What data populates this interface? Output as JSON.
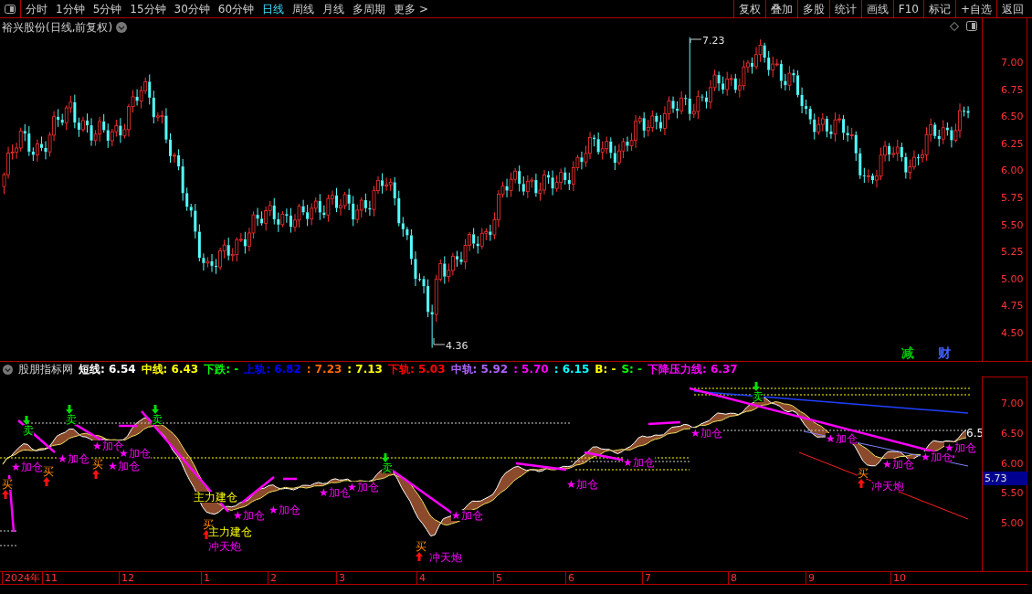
{
  "toolbar": {
    "periods": [
      {
        "label": "分时",
        "selected": false
      },
      {
        "label": "1分钟",
        "selected": false
      },
      {
        "label": "5分钟",
        "selected": false
      },
      {
        "label": "15分钟",
        "selected": false
      },
      {
        "label": "30分钟",
        "selected": false
      },
      {
        "label": "60分钟",
        "selected": false
      },
      {
        "label": "日线",
        "selected": true
      },
      {
        "label": "周线",
        "selected": false
      },
      {
        "label": "月线",
        "selected": false
      },
      {
        "label": "多周期",
        "selected": false
      }
    ],
    "more": "更多 >",
    "actions": [
      "复权",
      "叠加",
      "多股",
      "统计",
      "画线",
      "F10",
      "标记",
      "+自选",
      "返回"
    ]
  },
  "chart_title": "裕兴股份(日线,前复权)",
  "price_axis": [
    "7.00",
    "6.75",
    "6.50",
    "6.25",
    "6.00",
    "5.75",
    "5.50",
    "5.25",
    "5.00",
    "4.75",
    "4.50"
  ],
  "price_annotations": {
    "high": "7.23",
    "low": "4.36"
  },
  "badges": [
    {
      "text": "减",
      "color": "#00c000"
    },
    {
      "text": "财",
      "color": "#4060ff"
    }
  ],
  "indicator": {
    "name": "股朋指标网",
    "readouts": [
      {
        "text": "短线: 6.54",
        "color": "#ffffff"
      },
      {
        "text": "中线: 6.43",
        "color": "#ffff00"
      },
      {
        "text": "下跌: -",
        "color": "#00ff00"
      },
      {
        "text": "上轨: 6.82",
        "color": "#0000ff"
      },
      {
        "text": ": 7.23",
        "color": "#ff6600"
      },
      {
        "text": ": 7.13",
        "color": "#ffff00"
      },
      {
        "text": "下轨: 5.03",
        "color": "#ff0000"
      },
      {
        "text": "中轨: 5.92",
        "color": "#b060ff"
      },
      {
        "text": ": 5.70",
        "color": "#ff00ff"
      },
      {
        "text": ": 6.15",
        "color": "#00ffff"
      },
      {
        "text": "B: -",
        "color": "#ffff00"
      },
      {
        "text": "S: -",
        "color": "#00ff00"
      },
      {
        "text": "下降压力线: 6.37",
        "color": "#ff00ff"
      }
    ],
    "axis": [
      "7.00",
      "6.50",
      "6.00",
      "5.50",
      "5.00"
    ],
    "current_value": "5.73",
    "value_tag": "6.5",
    "markers": [
      {
        "kind": "add",
        "text": "★加仓"
      },
      {
        "kind": "add",
        "text": "★加仓"
      },
      {
        "kind": "add",
        "text": "★加仓"
      },
      {
        "kind": "add",
        "text": "★加仓"
      },
      {
        "kind": "add",
        "text": "★加仓"
      },
      {
        "kind": "add",
        "text": "★加仓"
      },
      {
        "kind": "add",
        "text": "★加仓"
      },
      {
        "kind": "add",
        "text": "★加仓"
      },
      {
        "kind": "add",
        "text": "★加仓"
      },
      {
        "kind": "add",
        "text": "★加仓"
      },
      {
        "kind": "add",
        "text": "★加仓"
      },
      {
        "kind": "add",
        "text": "★加仓"
      },
      {
        "kind": "add",
        "text": "★加仓"
      },
      {
        "kind": "add",
        "text": "★加仓"
      },
      {
        "kind": "add",
        "text": "★加仓"
      },
      {
        "kind": "add",
        "text": "★加仓"
      },
      {
        "kind": "add",
        "text": "★加仓"
      },
      {
        "kind": "sell",
        "text": "卖"
      },
      {
        "kind": "sell",
        "text": "卖"
      },
      {
        "kind": "sell",
        "text": "卖"
      },
      {
        "kind": "sell",
        "text": "卖"
      },
      {
        "kind": "sell",
        "text": "卖"
      },
      {
        "kind": "buy",
        "text": "买"
      },
      {
        "kind": "buy",
        "text": "买"
      },
      {
        "kind": "buy",
        "text": "买"
      },
      {
        "kind": "buy",
        "text": "买"
      },
      {
        "kind": "buy",
        "text": "买"
      },
      {
        "kind": "buy",
        "text": "买"
      },
      {
        "kind": "build",
        "text": "主力建仓"
      },
      {
        "kind": "build",
        "text": "主力建仓"
      },
      {
        "kind": "rocket",
        "text": "冲天炮"
      },
      {
        "kind": "rocket",
        "text": "冲天炮"
      },
      {
        "kind": "rocket",
        "text": "冲天炮"
      }
    ]
  },
  "time_axis": [
    "2024年",
    "11",
    "12",
    "1",
    "2",
    "3",
    "4",
    "5",
    "6",
    "7",
    "8",
    "9",
    "10"
  ]
}
